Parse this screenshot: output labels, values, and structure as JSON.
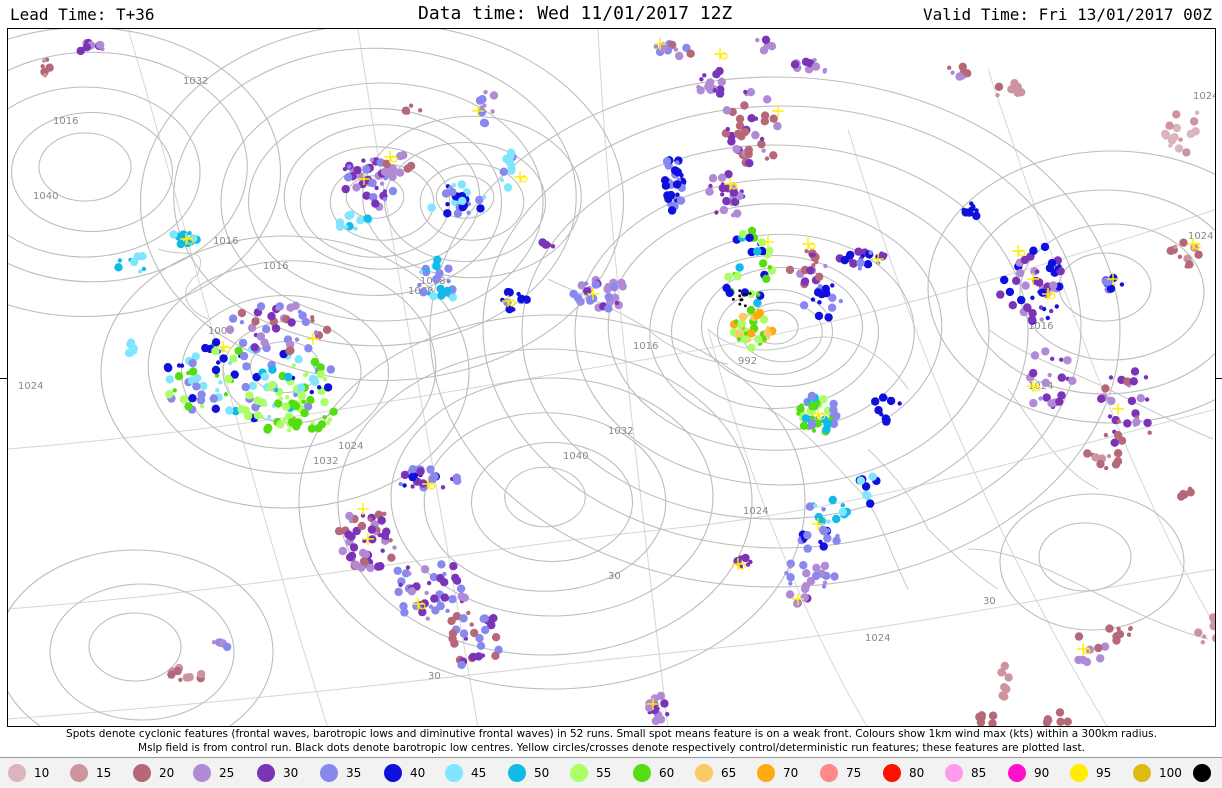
{
  "header": {
    "lead_time": "Lead Time: T+36",
    "data_time": "Data time:  Wed 11/01/2017 12Z",
    "valid_time": "Valid Time: Fri 13/01/2017 00Z"
  },
  "caption": {
    "line1": "Spots denote cyclonic features (frontal waves, barotropic lows and diminutive frontal waves) in 52 runs. Small spot means feature is on a weak front. Colours show 1km wind max (kts) within a 300km radius.",
    "line2": "Mslp field is from control run. Black dots denote barotropic low centres. Yellow circles/crosses denote respectively control/deterministic run features; these features are plotted last."
  },
  "legend": [
    {
      "label": "10",
      "color": "#d8b6bc"
    },
    {
      "label": "15",
      "color": "#cd94a0"
    },
    {
      "label": "20",
      "color": "#b66878"
    },
    {
      "label": "25",
      "color": "#b08ad4"
    },
    {
      "label": "30",
      "color": "#7b34b8"
    },
    {
      "label": "35",
      "color": "#8888ee"
    },
    {
      "label": "40",
      "color": "#1010dd"
    },
    {
      "label": "45",
      "color": "#80e6ff"
    },
    {
      "label": "50",
      "color": "#10bbe8"
    },
    {
      "label": "55",
      "color": "#aaff66"
    },
    {
      "label": "60",
      "color": "#55dd11"
    },
    {
      "label": "65",
      "color": "#ffc866"
    },
    {
      "label": "70",
      "color": "#ffaa11"
    },
    {
      "label": "75",
      "color": "#ff8888"
    },
    {
      "label": "80",
      "color": "#ff1100"
    },
    {
      "label": "85",
      "color": "#ff99ee"
    },
    {
      "label": "90",
      "color": "#ff11cc"
    },
    {
      "label": "95",
      "color": "#ffee00"
    },
    {
      "label": "100",
      "color": "#ddbb11"
    },
    {
      "label": "",
      "color": "#000000"
    }
  ],
  "isobar_labels": [
    {
      "text": "1032"
    },
    {
      "text": "1040"
    },
    {
      "text": "1016"
    },
    {
      "text": "1016"
    },
    {
      "text": "1008"
    },
    {
      "text": "1008"
    },
    {
      "text": "1000"
    },
    {
      "text": "1024"
    },
    {
      "text": "1032"
    },
    {
      "text": "1040"
    },
    {
      "text": "1032"
    },
    {
      "text": "1024"
    },
    {
      "text": "1016"
    },
    {
      "text": "992"
    },
    {
      "text": "1024"
    },
    {
      "text": "1024"
    },
    {
      "text": "1024"
    },
    {
      "text": "1016"
    },
    {
      "text": "1024"
    },
    {
      "text": "1024"
    },
    {
      "text": "1016"
    }
  ],
  "graticule_labels": [
    {
      "text": "30"
    },
    {
      "text": "30"
    },
    {
      "text": "30"
    }
  ]
}
